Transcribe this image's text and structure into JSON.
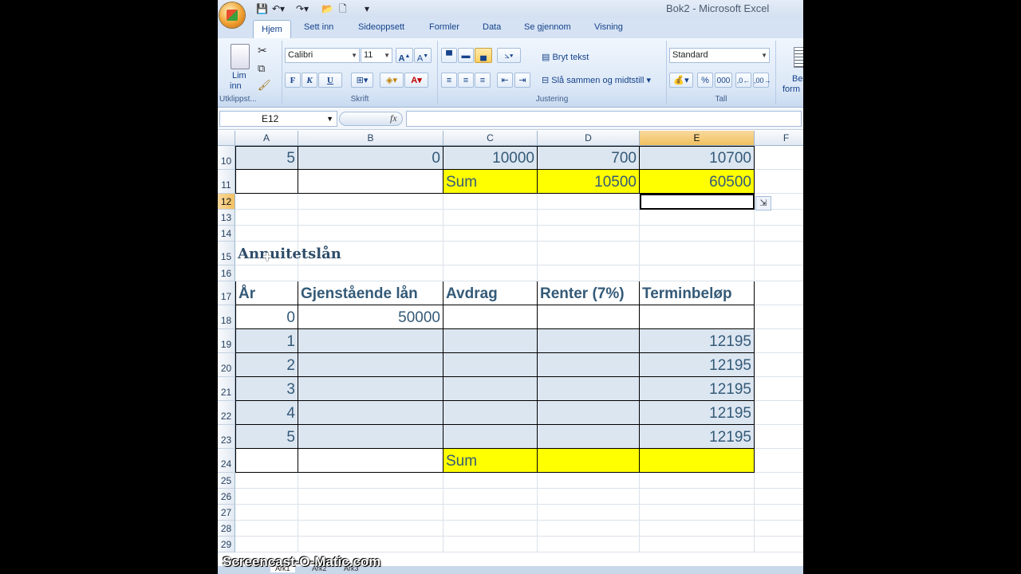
{
  "window": {
    "title": "Bok2 - Microsoft Excel"
  },
  "ribbon": {
    "tabs": [
      "Hjem",
      "Sett inn",
      "Sideoppsett",
      "Formler",
      "Data",
      "Se gjennom",
      "Visning"
    ],
    "clipboard": {
      "paste_label_1": "Lim",
      "paste_label_2": "inn",
      "group": "Utklippst..."
    },
    "font": {
      "name": "Calibri",
      "size": "11",
      "bold": "F",
      "italic": "K",
      "underline": "U",
      "group": "Skrift"
    },
    "alignment": {
      "wrap": "Bryt tekst",
      "merge": "Slå sammen og midtstill",
      "group": "Justering"
    },
    "number": {
      "format": "Standard",
      "percent": "%",
      "thousands": "000",
      "group": "Tall"
    },
    "styles": {
      "label_1": "Be",
      "label_2": "form"
    }
  },
  "formula_bar": {
    "name_box": "E12",
    "fx": "fx",
    "value": ""
  },
  "columns": [
    "A",
    "B",
    "C",
    "D",
    "E",
    "F"
  ],
  "rows": [
    {
      "n": "10",
      "A": "5",
      "B": "0",
      "C": "10000",
      "D": "700",
      "E": "10700"
    },
    {
      "n": "11",
      "A": "",
      "B": "",
      "C": "Sum",
      "D": "10500",
      "E": "60500"
    },
    {
      "n": "12"
    },
    {
      "n": "13"
    },
    {
      "n": "14"
    },
    {
      "n": "15",
      "A": "Annuitetslån"
    },
    {
      "n": "16"
    },
    {
      "n": "17",
      "A": "År",
      "B": "Gjenstående lån",
      "C": "Avdrag",
      "D": "Renter (7%)",
      "E": "Terminbeløp"
    },
    {
      "n": "18",
      "A": "0",
      "B": "50000"
    },
    {
      "n": "19",
      "A": "1",
      "E": "12195"
    },
    {
      "n": "20",
      "A": "2",
      "E": "12195"
    },
    {
      "n": "21",
      "A": "3",
      "E": "12195"
    },
    {
      "n": "22",
      "A": "4",
      "E": "12195"
    },
    {
      "n": "23",
      "A": "5",
      "E": "12195"
    },
    {
      "n": "24",
      "C": "Sum"
    },
    {
      "n": "25"
    },
    {
      "n": "26"
    },
    {
      "n": "27"
    },
    {
      "n": "28"
    },
    {
      "n": "29"
    }
  ],
  "sheets": [
    "Ark1",
    "Ark2",
    "Ark3"
  ],
  "watermark": "Screencast-O-Matic.com",
  "colors": {
    "yellow": "#ffff00",
    "band": "#dce6f1",
    "text": "#345a78"
  }
}
